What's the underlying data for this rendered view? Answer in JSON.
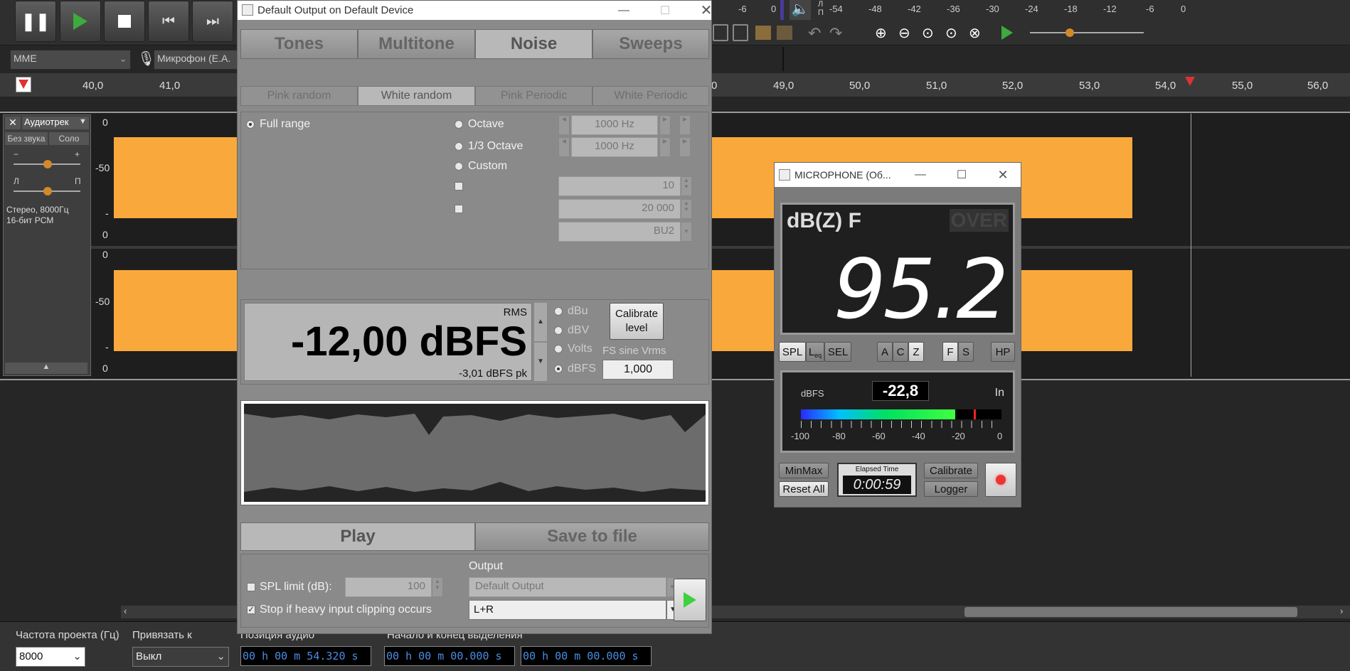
{
  "transport": {
    "buttons": [
      "pause-icon",
      "play-icon",
      "stop-icon",
      "skip-start-icon",
      "skip-end-icon"
    ]
  },
  "meter_scale": [
    "-6",
    "0",
    "-54",
    "-48",
    "-42",
    "-36",
    "-30",
    "-24",
    "-18",
    "-12",
    "-6",
    "0"
  ],
  "meter_lr": {
    "l": "Л",
    "r": "П"
  },
  "device": {
    "host": "MME",
    "input": "Микрофон (E.A."
  },
  "ruler": {
    "left_ticks": [
      "40,0",
      "41,0"
    ],
    "right_ticks": [
      "0",
      "49,0",
      "50,0",
      "51,0",
      "52,0",
      "53,0",
      "54,0",
      "55,0",
      "56,0"
    ]
  },
  "track": {
    "name": "Аудиотрек",
    "mute": "Без звука",
    "solo": "Соло",
    "gain_minus": "−",
    "gain_plus": "+",
    "pan_l": "Л",
    "pan_r": "П",
    "info1": "Стерео, 8000Гц",
    "info2": "16-бит PCM",
    "scale": [
      "0",
      "-50",
      "-",
      "0",
      "0",
      "-50",
      "-",
      "0"
    ]
  },
  "bottom": {
    "rate_label": "Частота проекта (Гц)",
    "snap_label": "Привязать к",
    "pos_label": "Позиция аудио",
    "sel_label": "Начало и конец выделения",
    "rate": "8000",
    "snap": "Выкл",
    "t1": "00 h 00 m 54.320 s",
    "t2": "00 h 00 m 00.000 s",
    "t3": "00 h 00 m 00.000 s"
  },
  "gen": {
    "title": "Default Output on Default Device",
    "tabs": [
      "Tones",
      "Multitone",
      "Noise",
      "Sweeps"
    ],
    "subtabs": [
      "Pink random",
      "White random",
      "Pink Periodic",
      "White Periodic"
    ],
    "full_range": "Full range",
    "octave": "Octave",
    "third_octave": "1/3 Octave",
    "custom": "Custom",
    "hz1": "1000 Hz",
    "hz2": "1000 Hz",
    "low": "10",
    "high": "20 000",
    "filter": "BU2",
    "rms": "RMS",
    "level": "-12,00 dBFS",
    "peak": "-3,01 dBFS pk",
    "units": [
      "dBu",
      "dBV",
      "Volts",
      "dBFS"
    ],
    "calibrate": "Calibrate level",
    "fs_label": "FS sine Vrms",
    "fs_value": "1,000",
    "play": "Play",
    "save": "Save to file",
    "spl_limit": "SPL limit (dB):",
    "spl_value": "100",
    "stop_clip": "Stop if heavy input clipping occurs",
    "output_label": "Output",
    "output": "Default Output",
    "channel": "L+R"
  },
  "mic": {
    "title": "MICROPHONE (Об...",
    "weighting": "dB(Z) F",
    "over": "OVER",
    "value": "95.2",
    "buttons": [
      "SPL",
      "L",
      "SEL",
      "A",
      "C",
      "Z",
      "F",
      "S",
      "HP"
    ],
    "leq_sub": "eq",
    "dbfs_label": "dBFS",
    "dbfs_value": "-22,8",
    "input": "In",
    "scale": [
      "-100",
      "-80",
      "-60",
      "-40",
      "-20",
      "0"
    ],
    "bar_level": 0.77,
    "minmax": "MinMax",
    "reset": "Reset All",
    "elapsed_label": "Elapsed Time",
    "elapsed": "0:00:59",
    "calibrate": "Calibrate",
    "logger": "Logger"
  }
}
